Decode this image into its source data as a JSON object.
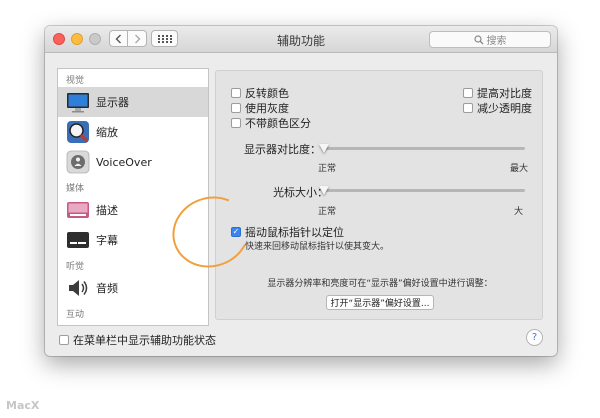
{
  "window": {
    "title": "辅助功能",
    "search_placeholder": "搜索"
  },
  "sidebar": {
    "sections": [
      {
        "header": "视觉",
        "items": [
          {
            "label": "显示器",
            "icon": "display-icon",
            "selected": true
          },
          {
            "label": "缩放",
            "icon": "zoom-icon",
            "selected": false
          },
          {
            "label": "VoiceOver",
            "icon": "voiceover-icon",
            "selected": false
          }
        ]
      },
      {
        "header": "媒体",
        "items": [
          {
            "label": "描述",
            "icon": "descriptions-icon",
            "selected": false
          },
          {
            "label": "字幕",
            "icon": "captions-icon",
            "selected": false
          }
        ]
      },
      {
        "header": "听觉",
        "items": [
          {
            "label": "音频",
            "icon": "audio-icon",
            "selected": false
          }
        ]
      },
      {
        "header": "互动",
        "items": []
      }
    ]
  },
  "display": {
    "checkboxes": {
      "invert_colors": {
        "label": "反转颜色",
        "checked": false
      },
      "use_grayscale": {
        "label": "使用灰度",
        "checked": false
      },
      "differentiate_without_color": {
        "label": "不带颜色区分",
        "checked": false
      },
      "increase_contrast": {
        "label": "提高对比度",
        "checked": false
      },
      "reduce_transparency": {
        "label": "减少透明度",
        "checked": false
      }
    },
    "contrast": {
      "label": "显示器对比度：",
      "min_label": "正常",
      "max_label": "最大",
      "value": 0
    },
    "cursor_size": {
      "label": "光标大小：",
      "min_label": "正常",
      "max_label": "大",
      "value": 0
    },
    "shake_to_locate": {
      "label": "摇动鼠标指针以定位",
      "checked": true,
      "description": "快速来回移动鼠标指针以使其变大。"
    },
    "note": "显示器分辨率和亮度可在“显示器”偏好设置中进行调整：",
    "open_button": "打开“显示器”偏好设置..."
  },
  "footer": {
    "show_status_label": "在菜单栏中显示辅助功能状态",
    "show_status_checked": false,
    "help": "?"
  },
  "watermark": "MacX",
  "colors": {
    "accent": "#3b85f0",
    "annotation": "#f0a040"
  }
}
